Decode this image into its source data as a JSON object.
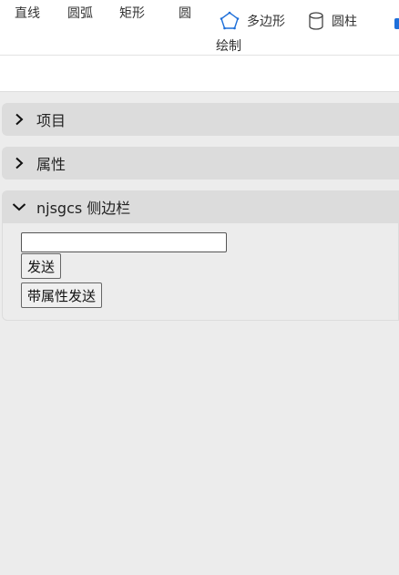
{
  "toolbar": {
    "line": "直线",
    "arc": "圆弧",
    "rect": "矩形",
    "circle": "圆",
    "polygon": "多边形",
    "cylinder": "圆柱",
    "group_label": "绘制"
  },
  "panel": {
    "sections": [
      {
        "title": "项目",
        "expanded": false
      },
      {
        "title": "属性",
        "expanded": false
      },
      {
        "title": "njsgcs 侧边栏",
        "expanded": true
      }
    ],
    "input_value": "",
    "send_label": "发送",
    "send_with_props_label": "带属性发送"
  },
  "colors": {
    "accent": "#1e6fd9",
    "panel_bg": "#ececec",
    "header_bg": "#dcdcdc"
  },
  "icons": {
    "polygon": "pentagon-icon",
    "cylinder": "cylinder-icon",
    "collapsed": "chevron-right-icon",
    "expanded": "chevron-down-icon"
  }
}
